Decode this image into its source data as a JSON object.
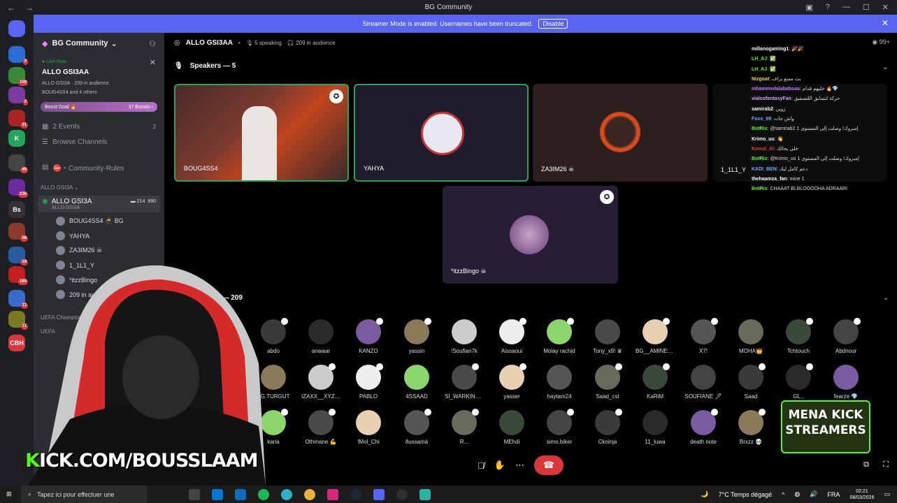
{
  "window": {
    "title": "BG Community"
  },
  "banner": {
    "text": "Streamer Mode is enabled. Usernames have been truncated.",
    "disable_label": "Disable"
  },
  "rail": [
    {
      "label": "",
      "badge": ""
    },
    {
      "label": "",
      "badge": "2"
    },
    {
      "label": "",
      "badge": "109"
    },
    {
      "label": "",
      "badge": "2"
    },
    {
      "label": "",
      "badge": "31"
    },
    {
      "label": "K",
      "badge": ""
    },
    {
      "label": "",
      "badge": "49"
    },
    {
      "label": "",
      "badge": "236"
    },
    {
      "label": "Bs",
      "badge": ""
    },
    {
      "label": "",
      "badge": "58"
    },
    {
      "label": "",
      "badge": "19"
    },
    {
      "label": "",
      "badge": "165"
    },
    {
      "label": "",
      "badge": "11"
    },
    {
      "label": "",
      "badge": "11"
    },
    {
      "label": "CBH",
      "badge": ""
    }
  ],
  "sidebar": {
    "guild_name": "BG Community",
    "live_label": "● Live Now",
    "stage_title": "ALLO GSI3AA",
    "stage_meta1": "ALLO GSI3A · 209 in audience",
    "stage_meta2": "BOUG4SS4 and 4 others",
    "boost_label": "Boost Goal 🔥",
    "boost_value": "37 Boosts ›",
    "events_label": "2 Events",
    "events_count": "2",
    "browse_label": "Browse Channels",
    "rules_label": "⛔・Community-Rules",
    "category": "ALLO GSI3A ⌄",
    "voice_channel": "ALLO GSI3A",
    "voice_sub": "ALLO GSI3A",
    "voice_count1": "214",
    "voice_count2": "990",
    "members": [
      "BOUG4SS4 🥷 BG",
      "YAHYA",
      "ZA3IM26 ☠",
      "1_1L1_Y",
      "*itzzBingo",
      "209 in audience"
    ],
    "category2": "UEFA Champions",
    "category3": "UEFA"
  },
  "stage": {
    "title": "ALLO GSI3AA",
    "speaking": "5 speaking",
    "audience_count": "209 in audience",
    "speakers_label": "Speakers — 5",
    "audience_label": "dience — 209",
    "speakers": [
      "BOUG4SS4",
      "YAHYA",
      "ZA3IM26 ☠",
      "1_1L1_Y",
      "*itzzBingo ☠"
    ]
  },
  "audience": [
    [
      "abdo",
      "anwaar",
      "KANZO",
      "yassin",
      "!Soufian7k",
      "Aissaoui",
      "Molay rachid",
      "Tony_x9! ♛",
      "BG__AMINE_...",
      "X7!",
      "MOHA👑",
      "Tchtouch",
      "Abdnour"
    ],
    [
      "BG.TURGUT",
      "IZAXX__XYZ 👾",
      "PABLO",
      "4SSAAD",
      "SI_WARKINGv™",
      "yasser",
      "haytam24",
      "Saad_cst",
      "KaRiM",
      "SOUFIANE 🖊",
      "Saad",
      "GL..",
      "fearze 💎"
    ],
    [
      "karia",
      "Othmane 💪",
      "!Mol_Chi",
      "ðussamä",
      "R...",
      "MEhdi",
      "simo.biker",
      "Ckninja",
      "11_luwa",
      "death note",
      "Brxzz 💀",
      "",
      ""
    ]
  ],
  "chat": [
    {
      "user": "millanogaming1",
      "msg": ": 🎉🎉",
      "color": "#ffffff"
    },
    {
      "user": "LH_AJ",
      "msg": ": ✅",
      "color": "#53fc18"
    },
    {
      "user": "LH_AJ",
      "msg": ": ✅",
      "color": "#53fc18"
    },
    {
      "user": "Nizgoat",
      "msg": ": بث ممتع بزاف",
      "color": "#f5d742"
    },
    {
      "user": "mhammedalababsaa",
      "msg": ": خليهم قدام 🔥💎",
      "color": "#b980ff"
    },
    {
      "user": "vialsofantasyFan",
      "msg": ": حركة لتسابق اللتصفيق",
      "color": "#d0a0ff"
    },
    {
      "user": "samirab2",
      "msg": ": زوين",
      "color": "#ffffff"
    },
    {
      "user": "Foxx_99",
      "msg": ": واش جات",
      "color": "#6fa8ff"
    },
    {
      "user": "BotRix",
      "msg": ": @samirab2 إمبروك! وصلت إلى المستوى 1",
      "color": "#53fc18"
    },
    {
      "user": "Krimo_uu",
      "msg": ": 👋",
      "color": "#ffffff"
    },
    {
      "user": "Kamal_Al",
      "msg": ": خلي بحالك",
      "color": "#e04040"
    },
    {
      "user": "BotRix",
      "msg": ": @Krimo_uu إمبروك! وصلت إلى المستوى 1",
      "color": "#53fc18"
    },
    {
      "user": "KADI_BEN",
      "msg": ": دعم كامل ليك",
      "color": "#6fa8ff"
    },
    {
      "user": "thehaamza_fan",
      "msg": ": mine 1",
      "color": "#ffffff"
    },
    {
      "user": "BotRix",
      "msg": ": CHAAAT BLBLOOOOHA ADRAARI",
      "color": "#53fc18"
    }
  ],
  "overlay": {
    "kick_prefix": "K",
    "kick_rest": "ICK.COM/BOUSSLAAM",
    "mena_line1": "MENA KICK",
    "mena_line2": "STREAMERS"
  },
  "taskbar": {
    "search_placeholder": "Tapez ici pour effectuer une",
    "weather": "7°C  Temps dégagé",
    "lang": "FRA",
    "time": "02:21",
    "date": "08/03/2026"
  },
  "colors": {
    "accent": "#5865f2",
    "live": "#23a55a",
    "danger": "#da373c",
    "kick": "#53fc18"
  }
}
